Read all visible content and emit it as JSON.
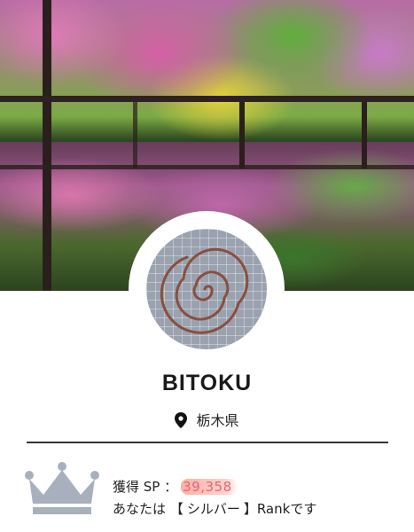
{
  "profile": {
    "username": "BITOKU",
    "location": "栃木県",
    "location_icon": "map-pin-icon",
    "avatar_icon": "spiral-avatar"
  },
  "rank": {
    "crown_icon": "crown-icon",
    "sp_label": "獲得 SP",
    "sp_separator": "：",
    "sp_value": "39,358",
    "rank_prefix": "あなたは",
    "rank_open": "【",
    "rank_name": "シルバー",
    "rank_close": "】",
    "rank_suffix": "Rankです"
  },
  "colors": {
    "sp_highlight": "#ffa096",
    "sp_text": "#d96a7a",
    "crown": "#a8b0bd",
    "divider": "#333333"
  }
}
